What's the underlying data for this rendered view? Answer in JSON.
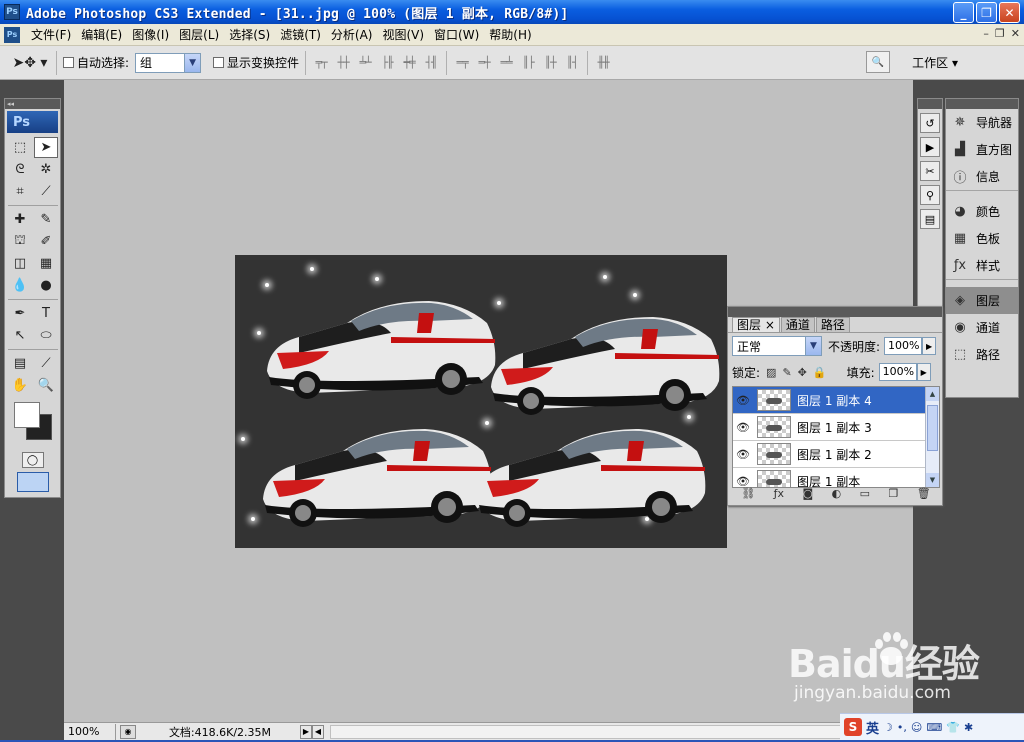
{
  "titlebar": {
    "icon": "Ps",
    "title": "Adobe Photoshop CS3 Extended - [31..jpg @ 100% (图层 1 副本, RGB/8#)]",
    "buttons": [
      "minimize",
      "restore",
      "close"
    ]
  },
  "menubar": {
    "app_icon": "Ps",
    "items": [
      "文件(F)",
      "编辑(E)",
      "图像(I)",
      "图层(L)",
      "选择(S)",
      "滤镜(T)",
      "分析(A)",
      "视图(V)",
      "窗口(W)",
      "帮助(H)"
    ]
  },
  "options": {
    "auto_select_label": "自动选择:",
    "auto_select_value": "组",
    "show_transform_label": "显示变换控件",
    "workspace_label": "工作区 ▾"
  },
  "toolbox": {
    "logo": "Ps"
  },
  "dock": {
    "group1": [
      {
        "label": "导航器",
        "icon": "navigator-icon"
      },
      {
        "label": "直方图",
        "icon": "histogram-icon"
      },
      {
        "label": "信息",
        "icon": "info-icon"
      }
    ],
    "group2": [
      {
        "label": "颜色",
        "icon": "color-icon"
      },
      {
        "label": "色板",
        "icon": "swatches-icon"
      },
      {
        "label": "样式",
        "icon": "styles-icon"
      }
    ],
    "group3": [
      {
        "label": "图层",
        "icon": "layers-icon"
      },
      {
        "label": "通道",
        "icon": "channels-icon"
      },
      {
        "label": "路径",
        "icon": "paths-icon"
      }
    ]
  },
  "layers_panel": {
    "tabs": [
      "图层 ×",
      "通道",
      "路径"
    ],
    "blend_mode": "正常",
    "opacity_label": "不透明度:",
    "opacity_value": "100%",
    "lock_label": "锁定:",
    "fill_label": "填充:",
    "fill_value": "100%",
    "layers": [
      {
        "name": "图层 1 副本 4",
        "selected": true
      },
      {
        "name": "图层 1 副本 3",
        "selected": false
      },
      {
        "name": "图层 1 副本 2",
        "selected": false
      },
      {
        "name": "图层 1 副本",
        "selected": false
      }
    ]
  },
  "statusbar": {
    "zoom": "100%",
    "doc_info": "文档:418.6K/2.35M"
  },
  "tray": {
    "ime": "英"
  },
  "watermark": {
    "brand": "Baidu经验",
    "url": "jingyan.baidu.com"
  }
}
